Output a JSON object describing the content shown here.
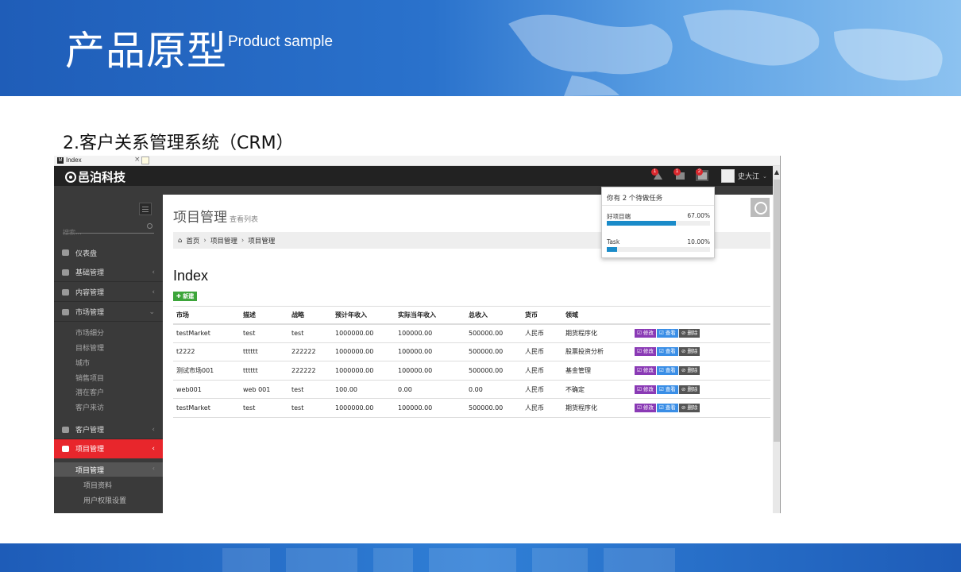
{
  "slide": {
    "title": "产品原型",
    "subtitle": "Product sample",
    "section_heading": "2.客户关系管理系统（CRM）"
  },
  "browser": {
    "tab_title": "Index",
    "tab_close": "×",
    "favicon": "M"
  },
  "app": {
    "logo": "邑泊科技",
    "user_name": "史大江",
    "notifications": [
      {
        "icon": "warning-icon",
        "count": "1"
      },
      {
        "icon": "envelope-icon",
        "count": "1"
      },
      {
        "icon": "tasks-icon",
        "count": "2"
      }
    ]
  },
  "sidebar": {
    "search_placeholder": "搜索...",
    "items": [
      {
        "label": "仪表盘",
        "arrow": ""
      },
      {
        "label": "基础管理",
        "arrow": "‹"
      },
      {
        "label": "内容管理",
        "arrow": "‹"
      },
      {
        "label": "市场管理",
        "arrow": "⌄"
      },
      {
        "label": "客户管理",
        "arrow": "‹"
      },
      {
        "label": "项目管理",
        "arrow": "‹"
      }
    ],
    "market_sub": [
      "市场细分",
      "目标管理",
      "城市",
      "销售项目",
      "潜在客户",
      "客户来访"
    ],
    "project_sub": {
      "label": "项目管理",
      "arrow": "‹"
    },
    "project_subsub": [
      "项目资料",
      "用户权限设置"
    ]
  },
  "page": {
    "title": "项目管理",
    "subtitle": "查看列表",
    "breadcrumb": [
      "首页",
      "项目管理",
      "项目管理"
    ],
    "heading": "Index",
    "new_button": "✚ 新建"
  },
  "table": {
    "columns": [
      "市场",
      "描述",
      "战略",
      "预计年收入",
      "实际当年收入",
      "总收入",
      "货币",
      "领域"
    ],
    "rows": [
      [
        "testMarket",
        "test",
        "test",
        "1000000.00",
        "100000.00",
        "500000.00",
        "人民币",
        "期货程序化"
      ],
      [
        "t2222",
        "tttttt",
        "222222",
        "1000000.00",
        "100000.00",
        "500000.00",
        "人民币",
        "股票投资分析"
      ],
      [
        "测试市场001",
        "tttttt",
        "222222",
        "1000000.00",
        "100000.00",
        "500000.00",
        "人民币",
        "基金管理"
      ],
      [
        "web001",
        "web 001",
        "test",
        "100.00",
        "0.00",
        "0.00",
        "人民币",
        "不确定"
      ],
      [
        "testMarket",
        "test",
        "test",
        "1000000.00",
        "100000.00",
        "500000.00",
        "人民币",
        "期货程序化"
      ]
    ],
    "actions": {
      "edit": "☑ 修改",
      "view": "☑ 查看",
      "delete": "⊘ 删除"
    }
  },
  "tasks_dropdown": {
    "header": "你有 2 个待做任务",
    "tasks": [
      {
        "name": "好项目端",
        "percent_label": "67.00%",
        "progress": 0.67
      },
      {
        "name": "Task",
        "percent_label": "10.00%",
        "progress": 0.1
      }
    ]
  },
  "colors": {
    "accent_red": "#e8262c",
    "edit": "#8a3ab5",
    "view": "#3a8ee6",
    "delete": "#555555",
    "new": "#3ca53a",
    "progress": "#1a8bc9"
  }
}
